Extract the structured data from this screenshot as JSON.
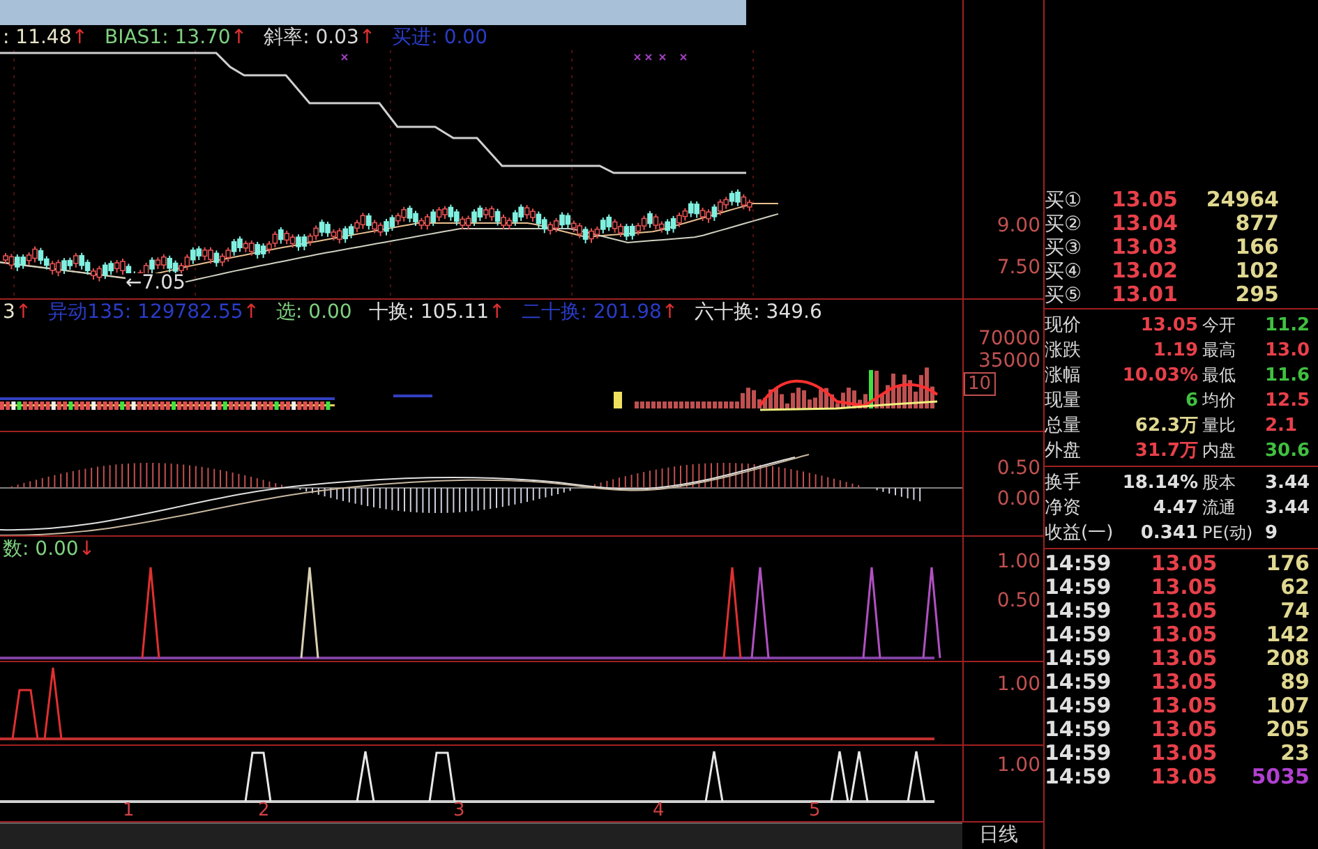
{
  "main_chart": {
    "legend": [
      {
        "text": ": 11.48",
        "arrow": "↑",
        "color": "#e8e4c8"
      },
      {
        "text": "BIAS1: 13.70",
        "arrow": "↑",
        "color": "#7fd07f"
      },
      {
        "text": "斜率: 0.03",
        "arrow": "↑",
        "color": "#d8d8d8"
      },
      {
        "text": "买进: 0.00",
        "color": "#2a3cc8"
      }
    ],
    "low_label": "←7.05",
    "axis_labels": [
      {
        "text": "9.00",
        "kind": "tick"
      },
      {
        "text": "7.50",
        "kind": "tick"
      }
    ]
  },
  "volume_chart": {
    "legend": [
      {
        "text": "3",
        "arrow": "↑",
        "color": "#e8e4c8"
      },
      {
        "text": "异动135: 129782.55",
        "arrow": "↑",
        "color": "#2a3cc8"
      },
      {
        "text": "选: 0.00",
        "color": "#7fd07f"
      },
      {
        "text": "十换: 105.11",
        "arrow": "↑",
        "color": "#e0e0e0"
      },
      {
        "text": "二十换: 201.98",
        "arrow": "↑",
        "color": "#2a3cc8"
      },
      {
        "text": "六十换: 349.6",
        "color": "#e0e0e0"
      }
    ],
    "axis_labels": [
      {
        "text": "70000",
        "kind": "tick"
      },
      {
        "text": "35000",
        "kind": "tick"
      },
      {
        "text": "10",
        "kind": "boxed"
      }
    ]
  },
  "macd_chart": {
    "axis_labels": [
      {
        "text": "0.50",
        "kind": "tick"
      },
      {
        "text": "0.00",
        "kind": "tick"
      }
    ]
  },
  "signal_chart_1": {
    "legend": [
      {
        "text": "数: 0.00",
        "arrow": "↓",
        "color": "#7fd07f"
      }
    ],
    "axis_labels": [
      {
        "text": "1.00",
        "kind": "tick"
      },
      {
        "text": "0.50",
        "kind": "tick"
      }
    ]
  },
  "signal_chart_2": {
    "axis_labels": [
      {
        "text": "1.00",
        "kind": "tick"
      }
    ]
  },
  "signal_chart_3": {
    "axis_labels": [
      {
        "text": "1.00",
        "kind": "tick"
      }
    ],
    "date_labels": [
      "1",
      "2",
      "3",
      "4",
      "5"
    ]
  },
  "period_label": "日线",
  "order_book": [
    {
      "label": "买①",
      "price": "13.05",
      "volume": "24964"
    },
    {
      "label": "买②",
      "price": "13.04",
      "volume": "877"
    },
    {
      "label": "买③",
      "price": "13.03",
      "volume": "166"
    },
    {
      "label": "买④",
      "price": "13.02",
      "volume": "102"
    },
    {
      "label": "买⑤",
      "price": "13.01",
      "volume": "295"
    }
  ],
  "quote_stats": [
    [
      {
        "label": "现价",
        "value": "13.05",
        "color": "#e8404a"
      },
      {
        "label": "今开",
        "value": "11.2",
        "color": "#40c040"
      }
    ],
    [
      {
        "label": "涨跌",
        "value": "1.19",
        "color": "#e8404a"
      },
      {
        "label": "最高",
        "value": "13.0",
        "color": "#e8404a"
      }
    ],
    [
      {
        "label": "涨幅",
        "value": "10.03%",
        "color": "#e8404a"
      },
      {
        "label": "最低",
        "value": "11.6",
        "color": "#40c040"
      }
    ],
    [
      {
        "label": "现量",
        "value": "6",
        "color": "#40c040"
      },
      {
        "label": "均价",
        "value": "12.5",
        "color": "#e8404a"
      }
    ],
    [
      {
        "label": "总量",
        "value": "62.3万",
        "color": "#e0d890"
      },
      {
        "label": "量比",
        "value": "2.1",
        "color": "#e8404a"
      }
    ],
    [
      {
        "label": "外盘",
        "value": "31.7万",
        "color": "#e8404a"
      },
      {
        "label": "内盘",
        "value": "30.6",
        "color": "#40c040"
      }
    ]
  ],
  "fundamentals": [
    [
      {
        "label": "换手",
        "value": "18.14%",
        "color": "#e0e0e0"
      },
      {
        "label": "股本",
        "value": "3.44",
        "color": "#e0e0e0"
      }
    ],
    [
      {
        "label": "净资",
        "value": "4.47",
        "color": "#e0e0e0"
      },
      {
        "label": "流通",
        "value": "3.44",
        "color": "#e0e0e0"
      }
    ],
    [
      {
        "label": "收益(一)",
        "value": "0.341",
        "color": "#e0e0e0"
      },
      {
        "label": "PE(动)",
        "value": "9",
        "color": "#e0e0e0"
      }
    ]
  ],
  "trades": [
    {
      "time": "14:59",
      "price": "13.05",
      "volume": "176",
      "color": "#e0d890"
    },
    {
      "time": "14:59",
      "price": "13.05",
      "volume": "62",
      "color": "#e0d890"
    },
    {
      "time": "14:59",
      "price": "13.05",
      "volume": "74",
      "color": "#e0d890"
    },
    {
      "time": "14:59",
      "price": "13.05",
      "volume": "142",
      "color": "#e0d890"
    },
    {
      "time": "14:59",
      "price": "13.05",
      "volume": "208",
      "color": "#e0d890"
    },
    {
      "time": "14:59",
      "price": "13.05",
      "volume": "89",
      "color": "#e0d890"
    },
    {
      "time": "14:59",
      "price": "13.05",
      "volume": "107",
      "color": "#e0d890"
    },
    {
      "time": "14:59",
      "price": "13.05",
      "volume": "205",
      "color": "#e0d890"
    },
    {
      "time": "14:59",
      "price": "13.05",
      "volume": "23",
      "color": "#e0d890"
    },
    {
      "time": "14:59",
      "price": "13.05",
      "volume": "5035",
      "color": "#b040d0"
    }
  ]
}
